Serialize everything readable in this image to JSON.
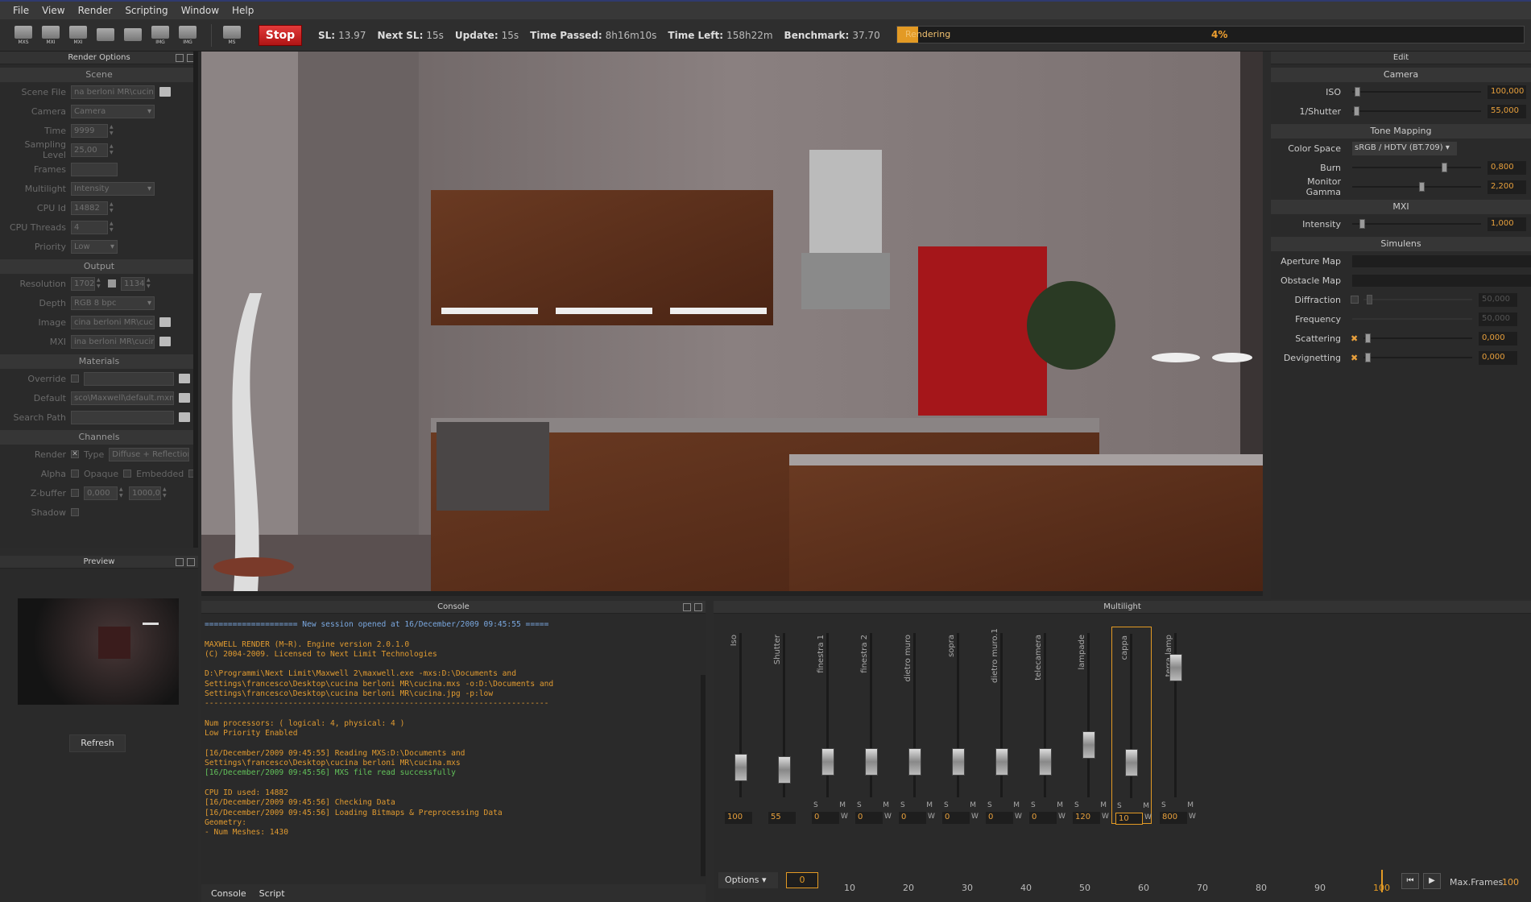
{
  "menu": [
    "File",
    "View",
    "Render",
    "Scripting",
    "Window",
    "Help"
  ],
  "toolbar": {
    "icons": [
      {
        "name": "open-mxs-icon",
        "label": "MXS"
      },
      {
        "name": "save-mxi-icon",
        "label": "MXI"
      },
      {
        "name": "mxi-icon",
        "label": "MXI"
      },
      {
        "name": "grid-icon",
        "label": ""
      },
      {
        "name": "save-icon",
        "label": ""
      },
      {
        "name": "save-img-icon",
        "label": "IMG"
      },
      {
        "name": "img-icon",
        "label": "IMG"
      },
      {
        "name": "ms-icon",
        "label": "MS"
      }
    ],
    "stop_label": "Stop",
    "stats": [
      {
        "label": "SL:",
        "value": "13.97"
      },
      {
        "label": "Next SL:",
        "value": "15s"
      },
      {
        "label": "Update:",
        "value": "15s"
      },
      {
        "label": "Time Passed:",
        "value": "8h16m10s"
      },
      {
        "label": "Time Left:",
        "value": "158h22m"
      },
      {
        "label": "Benchmark:",
        "value": "37.70"
      }
    ],
    "progress_text": "Rendering",
    "progress_pct": "4%",
    "progress_value": 0.04
  },
  "render_options": {
    "title": "Render Options",
    "scene_section": "Scene",
    "scene_rows": [
      {
        "label": "Scene File",
        "value": "na berloni MR\\cucina.mxs",
        "w": 104,
        "extra": "folder"
      },
      {
        "label": "Camera",
        "value": "Camera",
        "w": 104,
        "extra": "dropdown"
      },
      {
        "label": "Time",
        "value": "9999",
        "w": 46,
        "extra": "spin"
      },
      {
        "label": "Sampling Level",
        "value": "25,00",
        "w": 46,
        "extra": "spin"
      },
      {
        "label": "Frames",
        "value": "",
        "w": 58,
        "extra": ""
      },
      {
        "label": "Multilight",
        "value": "Intensity",
        "w": 104,
        "extra": "dropdown"
      },
      {
        "label": "CPU Id",
        "value": "14882",
        "w": 46,
        "extra": "spin"
      },
      {
        "label": "CPU Threads",
        "value": "4",
        "w": 46,
        "extra": "spin"
      },
      {
        "label": "Priority",
        "value": "Low",
        "w": 58,
        "extra": "dropdown"
      }
    ],
    "output_section": "Output",
    "resolution_label": "Resolution",
    "res_w": "1702",
    "res_h": "1134",
    "output_rows": [
      {
        "label": "Depth",
        "value": "RGB  8 bpc",
        "w": 104,
        "extra": "dropdown"
      },
      {
        "label": "Image",
        "value": "cina berloni MR\\cucina.jpg",
        "w": 104,
        "extra": "folder"
      },
      {
        "label": "MXI",
        "value": "ina berloni MR\\cucina.mxi",
        "w": 104,
        "extra": "folder"
      }
    ],
    "materials_section": "Materials",
    "override_label": "Override",
    "default_label": "Default",
    "default_value": "sco\\Maxwell\\default.mxm",
    "search_label": "Search Path",
    "channels_section": "Channels",
    "render_label": "Render",
    "type_label": "Type",
    "type_value": "Diffuse + Reflection",
    "alpha_label": "Alpha",
    "opaque_label": "Opaque",
    "embedded_label": "Embedded",
    "zbuffer_label": "Z-buffer",
    "z_min": "0,000",
    "z_max": "1000,0",
    "shadow_label": "Shadow"
  },
  "preview": {
    "title": "Preview",
    "refresh": "Refresh"
  },
  "edit": {
    "title": "Edit",
    "camera_section": "Camera",
    "iso_label": "ISO",
    "iso_value": "100,000",
    "iso_pos": 0.02,
    "shutter_label": "1/Shutter",
    "shutter_value": "55,000",
    "shutter_pos": 0.01,
    "tone_section": "Tone Mapping",
    "colorspace_label": "Color Space",
    "colorspace_value": "sRGB / HDTV (BT.709)",
    "burn_label": "Burn",
    "burn_value": "0,800",
    "burn_pos": 0.74,
    "gamma_label": "Monitor Gamma",
    "gamma_value": "2,200",
    "gamma_pos": 0.55,
    "mxi_section": "MXI",
    "intensity_label": "Intensity",
    "intensity_value": "1,000",
    "intensity_pos": 0.06,
    "simulens_section": "Simulens",
    "aperture_label": "Aperture Map",
    "obstacle_label": "Obstacle Map",
    "diffraction_label": "Diffraction",
    "diffraction_value": "50,000",
    "frequency_label": "Frequency",
    "frequency_value": "50,000",
    "scattering_label": "Scattering",
    "scattering_value": "0,000",
    "devignetting_label": "Devignetting",
    "devignetting_value": "0,000"
  },
  "console": {
    "title": "Console",
    "lines": [
      {
        "text": "==================== New session opened at 16/December/2009 09:45:55 =====",
        "color": "#7aa8e0"
      },
      {
        "text": "",
        "color": "#e09a30"
      },
      {
        "text": "MAXWELL RENDER (M~R). Engine version 2.0.1.0",
        "color": "#e09a30"
      },
      {
        "text": "(C) 2004-2009. Licensed to Next Limit Technologies",
        "color": "#e09a30"
      },
      {
        "text": "",
        "color": "#e09a30"
      },
      {
        "text": "D:\\Programmi\\Next Limit\\Maxwell 2\\maxwell.exe -mxs:D:\\Documents and",
        "color": "#e09a30"
      },
      {
        "text": "Settings\\francesco\\Desktop\\cucina berloni MR\\cucina.mxs -o:D:\\Documents and",
        "color": "#e09a30"
      },
      {
        "text": "Settings\\francesco\\Desktop\\cucina berloni MR\\cucina.jpg -p:low",
        "color": "#e09a30"
      },
      {
        "text": "--------------------------------------------------------------------------",
        "color": "#e09a30"
      },
      {
        "text": "",
        "color": "#e09a30"
      },
      {
        "text": "Num processors: ( logical: 4, physical: 4 )",
        "color": "#e09a30"
      },
      {
        "text": "Low Priority Enabled",
        "color": "#e09a30"
      },
      {
        "text": "",
        "color": "#e09a30"
      },
      {
        "text": "[16/December/2009 09:45:55] Reading MXS:D:\\Documents and",
        "color": "#e09a30"
      },
      {
        "text": "Settings\\francesco\\Desktop\\cucina berloni MR\\cucina.mxs",
        "color": "#e09a30"
      },
      {
        "text": "[16/December/2009 09:45:56] MXS file read successfully",
        "color": "#62c25a"
      },
      {
        "text": "",
        "color": "#e09a30"
      },
      {
        "text": "CPU ID used: 14882",
        "color": "#e09a30"
      },
      {
        "text": "[16/December/2009 09:45:56] Checking Data",
        "color": "#e09a30"
      },
      {
        "text": "[16/December/2009 09:45:56] Loading Bitmaps & Preprocessing Data",
        "color": "#e09a30"
      },
      {
        "text": "Geometry:",
        "color": "#e09a30"
      },
      {
        "text": "- Num Meshes: 1430",
        "color": "#e09a30"
      }
    ],
    "tabs": [
      "Console",
      "Script"
    ]
  },
  "multilight": {
    "title": "Multilight",
    "strips": [
      {
        "name": "Iso",
        "value": "100",
        "knob": 0.88,
        "sm": false
      },
      {
        "name": "Shutter",
        "value": "55",
        "knob": 0.9,
        "sm": false
      },
      {
        "name": "finestra 1",
        "value": "0",
        "knob": 0.84,
        "sm": true
      },
      {
        "name": "finestra 2",
        "value": "0",
        "knob": 0.84,
        "sm": true
      },
      {
        "name": "dietro muro",
        "value": "0",
        "knob": 0.84,
        "sm": true
      },
      {
        "name": "sopra",
        "value": "0",
        "knob": 0.84,
        "sm": true
      },
      {
        "name": "dietro muro.1",
        "value": "0",
        "knob": 0.84,
        "sm": true
      },
      {
        "name": "telecamera",
        "value": "0",
        "knob": 0.84,
        "sm": true
      },
      {
        "name": "lampade",
        "value": "120",
        "knob": 0.72,
        "sm": true
      },
      {
        "name": "cappa",
        "value": "10",
        "knob": 0.84,
        "sm": true
      },
      {
        "name": "terra lamp",
        "value": "800",
        "knob": 0.15,
        "sm": true
      }
    ],
    "s_label": "S",
    "m_label": "M",
    "w_label": "W",
    "options_label": "Options",
    "frame_value": "0",
    "ticks": [
      "10",
      "20",
      "30",
      "40",
      "50",
      "60",
      "70",
      "80",
      "90",
      "100"
    ],
    "max_frames_label": "Max.Frames",
    "max_frames_value": "100"
  }
}
